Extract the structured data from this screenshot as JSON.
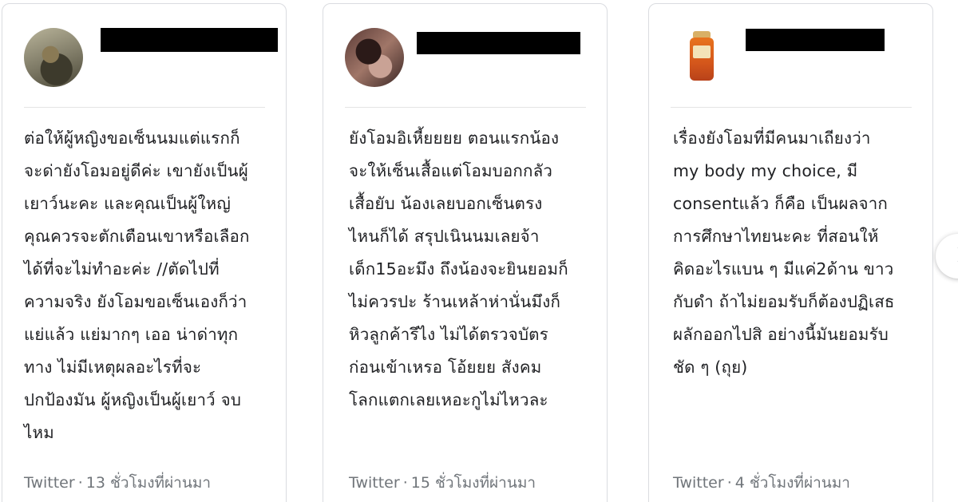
{
  "cards": [
    {
      "body": "ต่อให้ผู้หญิงขอเซ็นนมแต่แรกก็\nจะด่ายังโอมอยู่ดีค่ะ เขายังเป็นผู้\nเยาว์นะคะ และคุณเป็นผู้ใหญ่\nคุณควรจะตักเตือนเขาหรือเลือก\nได้ที่จะไม่ทำอะค่ะ //ตัดไปที่\nความจริง ยังโอมขอเซ็นเองก็ว่า\nแย่แล้ว แย่มากๆ เออ น่าด่าทุก\nทาง ไม่มีเหตุผลอะไรที่จะ\nปกป้องมัน ผู้หญิงเป็นผู้เยาว์ จบ\nไหม",
      "source": "Twitter",
      "time": "13 ชั่วโมงที่ผ่านมา"
    },
    {
      "body": "ยังโอมอิเหี้ยยยย ตอนแรกน้อง\nจะให้เซ็นเสื้อแต่โอมบอกกลัว\nเสื้อยับ น้องเลยบอกเซ็นตรง\nไหนก็ได้ สรุปเนินนมเลยจ้า\nเด็ก15อะมึง ถึงน้องจะยินยอมก็\nไม่ควรปะ ร้านเหล้าห่านั่นมึงก็\nหิวลูกค้ารึไง ไม่ได้ตรวจบัตร\nก่อนเข้าเหรอ โอ้ยยย สังคม\nโลกแตกเลยเหอะกูไม่ไหวละ",
      "source": "Twitter",
      "time": "15 ชั่วโมงที่ผ่านมา"
    },
    {
      "body": "เรื่องยังโอมที่มีคนมาเถียงว่า\nmy body my choice, มี\nconsentแล้ว ก็คือ เป็นผลจาก\nการศึกษาไทยนะคะ ที่สอนให้\nคิดอะไรแบน ๆ มีแค่2ด้าน ขาว\nกับดำ ถ้าไม่ยอมรับก็ต้องปฏิเสธ\nผลักออกไปสิ อย่างนี้มันยอมรับ\nชัด ๆ (ถุย)",
      "source": "Twitter",
      "time": "4 ชั่วโมงที่ผ่านมา"
    }
  ],
  "separator": "·",
  "icons": {
    "next": "chevron-right-icon"
  }
}
